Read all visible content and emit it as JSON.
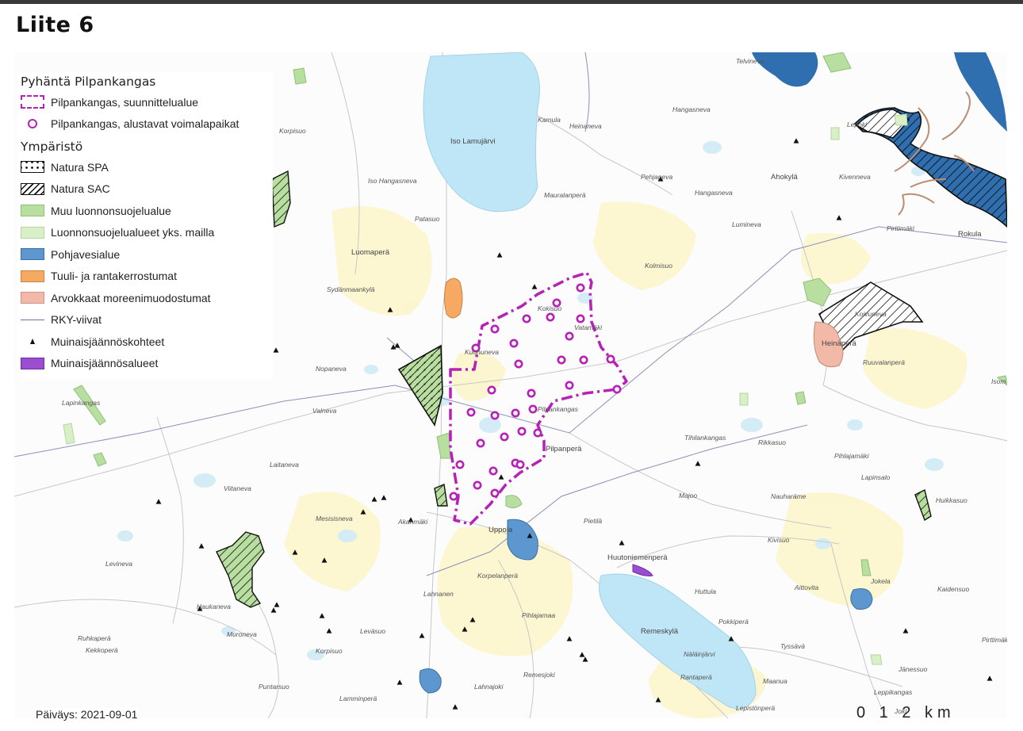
{
  "page_title": "Liite 6",
  "legend": {
    "project_heading": "Pyhäntä Pilpankangas",
    "project_items": [
      {
        "label": "Pilpankangas, suunnittelualue",
        "icon": "dashed-purple-boundary-icon"
      },
      {
        "label": "Pilpankangas, alustavat voimalapaikat",
        "icon": "purple-circle-icon"
      }
    ],
    "env_heading": "Ympäristö",
    "env_items": [
      {
        "label": "Natura SPA",
        "icon": "dotted-hatch-icon"
      },
      {
        "label": "Natura SAC",
        "icon": "diagonal-hatch-icon"
      },
      {
        "label": "Muu luonnonsuojelualue",
        "icon": "green-area-icon"
      },
      {
        "label": "Luonnonsuojelualueet yks. mailla",
        "icon": "light-green-area-icon"
      },
      {
        "label": "Pohjavesialue",
        "icon": "blue-area-icon"
      },
      {
        "label": "Tuuli- ja rantakerrostumat",
        "icon": "orange-area-icon"
      },
      {
        "label": "Arvokkaat moreenimuodostumat",
        "icon": "salmon-area-icon"
      },
      {
        "label": "RKY-viivat",
        "icon": "thin-line-icon"
      },
      {
        "label": "Muinaisjäännöskohteet",
        "icon": "black-triangle-icon"
      },
      {
        "label": "Muinaisjäännösalueet",
        "icon": "purple-area-icon"
      }
    ]
  },
  "colors": {
    "plan_boundary": "#b621b8",
    "turbine": "#b621b8",
    "water": "#bfe6f6",
    "groundwater": "#5d97cf",
    "nature_area": "#b8dea0",
    "nature_private": "#d8efc8",
    "wind_deposit": "#f6a962",
    "moraine": "#f2b9a8",
    "rky_line": "#8e8eb8",
    "heritage_area": "#9b4fd0"
  },
  "place_labels": [
    "Iso Lamujärvi",
    "Kamula",
    "Heinaneva",
    "Hangasneva",
    "Telvineva",
    "Lepoki",
    "Ahokylä",
    "Kivenneva",
    "Pirttimäki",
    "Rokula",
    "Pehjaneva",
    "Mauralanperä",
    "Hangasneva",
    "Luomaperä",
    "Lumineva",
    "Patasuo",
    "Iso Hangasneva",
    "Korpisuo",
    "Sydänmaankylä",
    "Kolmisuo",
    "Kokisuo",
    "Vatamäki",
    "Kuohuneva",
    "Koivuneva",
    "Heinäperä",
    "Ruuvalanperä",
    "Isom",
    "Nopaneva",
    "Valneva",
    "Lapinkangas",
    "Tihilankangas",
    "Rikkasuo",
    "Pihlajamäki",
    "Pilpankangas",
    "Laitaneva",
    "Pilpanperä",
    "Lapinsalo",
    "Viitaneva",
    "Mesisisneva",
    "Akanmäki",
    "Uppola",
    "Pietilä",
    "Majoo",
    "Nauharäme",
    "Huikkasuo",
    "Levineva",
    "Korpelanperä",
    "Huutoniemenperä",
    "Kivisuo",
    "Jokela",
    "Lahnanen",
    "Huttula",
    "Aittovita",
    "Kaidensuo",
    "Haukaneva",
    "Muroneva",
    "Pihlajamaa",
    "Remeskylä",
    "Pokkiperä",
    "Ruhkaperä",
    "Kekkoperä",
    "Korpisuo",
    "Leväsuo",
    "Tyssävä",
    "Pirttimäki",
    "Näläinjärvi",
    "Lahnajoki",
    "Remesjoki",
    "Rantaperä",
    "Jänessuo",
    "Puntarsuo",
    "Lamminperä",
    "Maanua",
    "Leppikangas",
    "Lepistönperä",
    "Joki"
  ],
  "date_label": "Päiväys: 2021-09-01",
  "scale_label": "0 1 2 km"
}
